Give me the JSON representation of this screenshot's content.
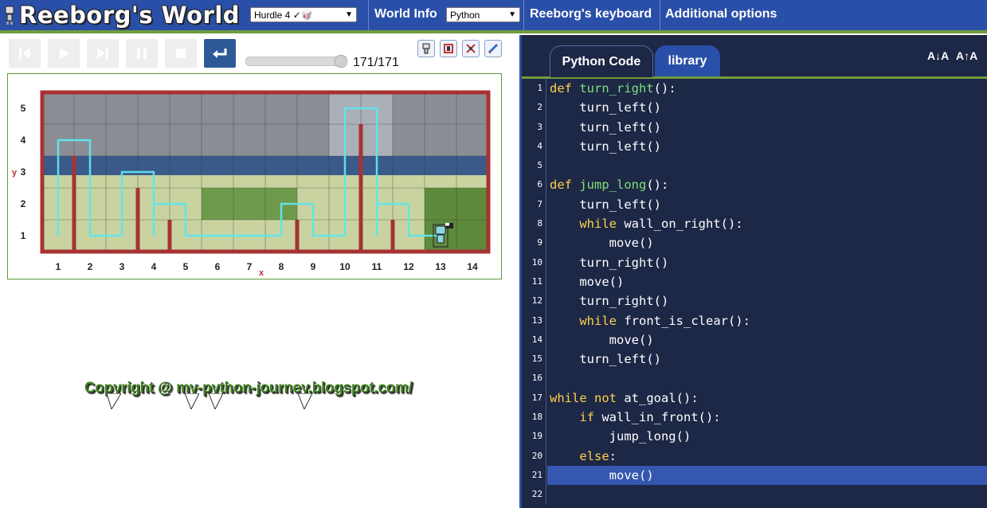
{
  "app": {
    "title": "Reeborg's World"
  },
  "topbar": {
    "world_select": "Hurdle 4 ✓🥡",
    "world_info": "World Info",
    "language_select": "Python",
    "keyboard": "Reeborg's keyboard",
    "options": "Additional options"
  },
  "controls": {
    "step_counter": "171/171",
    "progress": 1.0
  },
  "world": {
    "x_axis_letter": "x",
    "y_axis_letter": "y",
    "x_ticks": [
      "1",
      "2",
      "3",
      "4",
      "5",
      "6",
      "7",
      "8",
      "9",
      "10",
      "11",
      "12",
      "13",
      "14"
    ],
    "y_ticks": [
      "1",
      "2",
      "3",
      "4",
      "5"
    ],
    "colors": {
      "wall": "#a73232",
      "trace": "#5fe6ea",
      "border": "#a73232"
    }
  },
  "watermark": "Copyright @ my-python-journey.blogspot.com/",
  "editor": {
    "tab_python": "Python Code",
    "tab_library": "library",
    "font_decrease": "A↓A",
    "font_increase": "A↑A",
    "highlight_line": 21,
    "lines": [
      {
        "n": "1",
        "t": "def turn_right():"
      },
      {
        "n": "2",
        "t": "    turn_left()"
      },
      {
        "n": "3",
        "t": "    turn_left()"
      },
      {
        "n": "4",
        "t": "    turn_left()"
      },
      {
        "n": "5",
        "t": ""
      },
      {
        "n": "6",
        "t": "def jump_long():"
      },
      {
        "n": "7",
        "t": "    turn_left()"
      },
      {
        "n": "8",
        "t": "    while wall_on_right():"
      },
      {
        "n": "9",
        "t": "        move()"
      },
      {
        "n": "10",
        "t": "    turn_right()"
      },
      {
        "n": "11",
        "t": "    move()"
      },
      {
        "n": "12",
        "t": "    turn_right()"
      },
      {
        "n": "13",
        "t": "    while front_is_clear():"
      },
      {
        "n": "14",
        "t": "        move()"
      },
      {
        "n": "15",
        "t": "    turn_left()"
      },
      {
        "n": "16",
        "t": ""
      },
      {
        "n": "17",
        "t": "while not at_goal():"
      },
      {
        "n": "18",
        "t": "    if wall_in_front():"
      },
      {
        "n": "19",
        "t": "        jump_long()"
      },
      {
        "n": "20",
        "t": "    else:"
      },
      {
        "n": "21",
        "t": "        move()"
      },
      {
        "n": "22",
        "t": ""
      }
    ]
  }
}
